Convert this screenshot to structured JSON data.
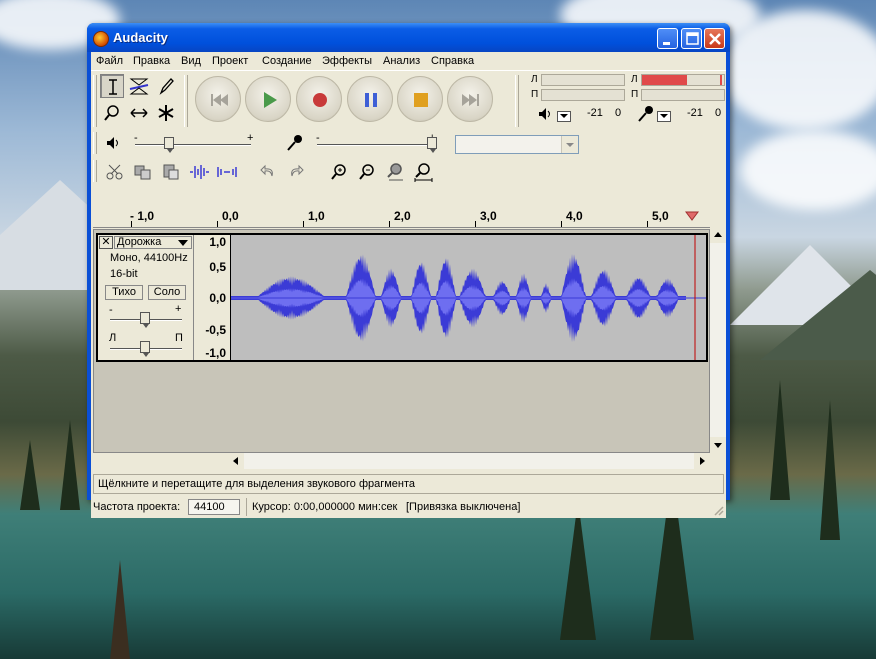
{
  "window": {
    "title": "Audacity",
    "controls": {
      "minimize": "minimize-icon",
      "maximize": "maximize-icon",
      "close": "close-icon"
    }
  },
  "menu": [
    "Файл",
    "Правка",
    "Вид",
    "Проект",
    "Создание",
    "Эффекты",
    "Анализ",
    "Справка"
  ],
  "meters": {
    "playback": {
      "left_label": "Л",
      "right_label": "П"
    },
    "record": {
      "left_label": "Л",
      "right_label": "П",
      "left_level": 0.55
    },
    "playback_scale": [
      "-21",
      "0"
    ],
    "record_scale": [
      "-21",
      "0"
    ]
  },
  "ruler": {
    "labels": [
      "- 1,0",
      "0,0",
      "1,0",
      "2,0",
      "3,0",
      "4,0",
      "5,0"
    ]
  },
  "track": {
    "close_label": "✕",
    "name": "Дорожка",
    "info_rate": "Моно, 44100Hz",
    "info_bits": "16-bit",
    "mute_label": "Тихо",
    "solo_label": "Соло",
    "gain_minus": "-",
    "gain_plus": "+",
    "pan_left": "Л",
    "pan_right": "П",
    "scale": [
      "1,0",
      "0,5",
      "0,0",
      "-0,5",
      "-1,0"
    ]
  },
  "colors": {
    "waveform": "#3b3bd6",
    "waveform_inner": "#6e6ef0",
    "wave_bg": "#bebebe",
    "meter_red": "#e04a4a",
    "cursor": "#c00000"
  },
  "status": {
    "hint": "Щёлкните и перетащите для выделения звукового фрагмента",
    "rate_label": "Частота проекта:",
    "rate_value": "44100",
    "cursor": "Курсор: 0:00,000000 мин:сек",
    "snap": "[Привязка выключена]"
  },
  "mixer": {
    "volume_minus": "-",
    "volume_plus": "+",
    "input_minus": "-",
    "input_plus": "+",
    "input_device": ""
  }
}
